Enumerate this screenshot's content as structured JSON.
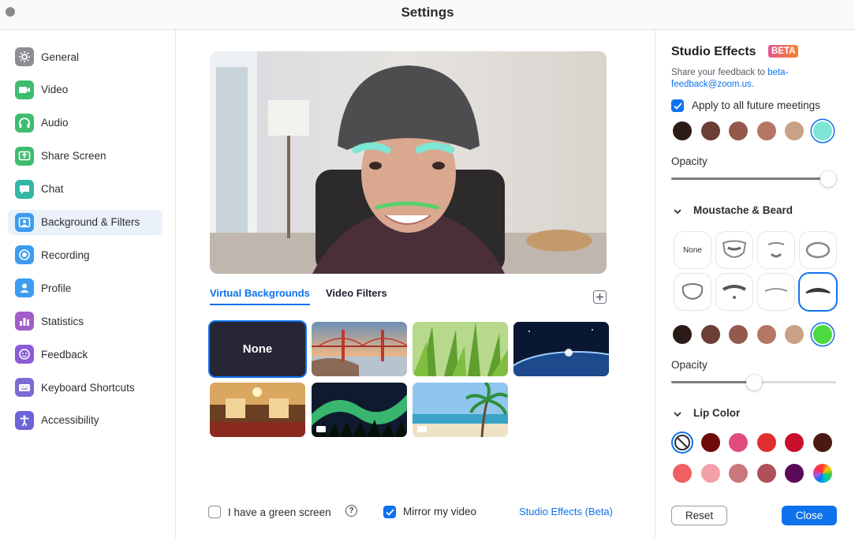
{
  "window": {
    "title": "Settings"
  },
  "sidebar": {
    "items": [
      {
        "label": "General",
        "icon": "gear-icon",
        "color": "#8d8d94"
      },
      {
        "label": "Video",
        "icon": "video-camera-icon",
        "color": "#3ebc6f"
      },
      {
        "label": "Audio",
        "icon": "headphones-icon",
        "color": "#3ebc6f"
      },
      {
        "label": "Share Screen",
        "icon": "share-screen-icon",
        "color": "#3ebc6f"
      },
      {
        "label": "Chat",
        "icon": "chat-icon",
        "color": "#33b8a6"
      },
      {
        "label": "Background & Filters",
        "icon": "background-icon",
        "color": "#3d9cf0"
      },
      {
        "label": "Recording",
        "icon": "recording-icon",
        "color": "#3d9cf0"
      },
      {
        "label": "Profile",
        "icon": "profile-icon",
        "color": "#3d9cf0"
      },
      {
        "label": "Statistics",
        "icon": "statistics-icon",
        "color": "#a15dc6"
      },
      {
        "label": "Feedback",
        "icon": "feedback-icon",
        "color": "#8c5bd6"
      },
      {
        "label": "Keyboard Shortcuts",
        "icon": "keyboard-icon",
        "color": "#7a6bd6"
      },
      {
        "label": "Accessibility",
        "icon": "accessibility-icon",
        "color": "#6c63d9"
      }
    ],
    "active_index": 5
  },
  "main": {
    "tabs": [
      {
        "label": "Virtual Backgrounds",
        "active": true
      },
      {
        "label": "Video Filters",
        "active": false
      }
    ],
    "backgrounds": [
      {
        "label": "None",
        "kind": "none",
        "selected": true
      },
      {
        "label": "golden-gate-bridge",
        "kind": "image"
      },
      {
        "label": "grass",
        "kind": "image"
      },
      {
        "label": "earth-from-space",
        "kind": "image"
      },
      {
        "label": "hotel-lobby",
        "kind": "image"
      },
      {
        "label": "aurora",
        "kind": "video"
      },
      {
        "label": "beach",
        "kind": "video"
      }
    ],
    "footer": {
      "green_screen_label": "I have a green screen",
      "green_screen_checked": false,
      "mirror_label": "Mirror my video",
      "mirror_checked": true,
      "studio_effects_link": "Studio Effects (Beta)"
    }
  },
  "studio": {
    "title": "Studio Effects",
    "badge": "BETA",
    "feedback_prefix": "Share your feedback to ",
    "feedback_email": "beta-feedback@zoom.us",
    "feedback_suffix": ".",
    "apply_label": "Apply to all future meetings",
    "apply_checked": true,
    "eyebrow_colors": [
      "#2b1b17",
      "#6b3f35",
      "#93594c",
      "#b57663",
      "#c9a184",
      "#7ee6d5"
    ],
    "eyebrow_selected": 5,
    "opacity_label": "Opacity",
    "eyebrow_opacity": 1.0,
    "moustache_section": "Moustache & Beard",
    "beard_none_label": "None",
    "beard_styles": [
      "none",
      "full-beard",
      "goatee",
      "chin-strap",
      "horseshoe",
      "handlebar",
      "thin",
      "walrus"
    ],
    "beard_selected": 7,
    "beard_colors": [
      "#2b1b17",
      "#6b3f35",
      "#93594c",
      "#b57663",
      "#c9a184",
      "#4cdb3e"
    ],
    "beard_color_selected": 5,
    "beard_opacity_label": "Opacity",
    "beard_opacity": 0.5,
    "lip_section": "Lip Color",
    "lip_colors_row1": [
      "none",
      "#6e0a0a",
      "#e04c7c",
      "#e02f2f",
      "#c8102e",
      "#4a1a12"
    ],
    "lip_colors_row2": [
      "#f06060",
      "#f4a0a8",
      "#c9777d",
      "#b0505a",
      "#5a0a57",
      "rainbow"
    ],
    "lip_selected": 0,
    "reset_label": "Reset",
    "close_label": "Close"
  }
}
